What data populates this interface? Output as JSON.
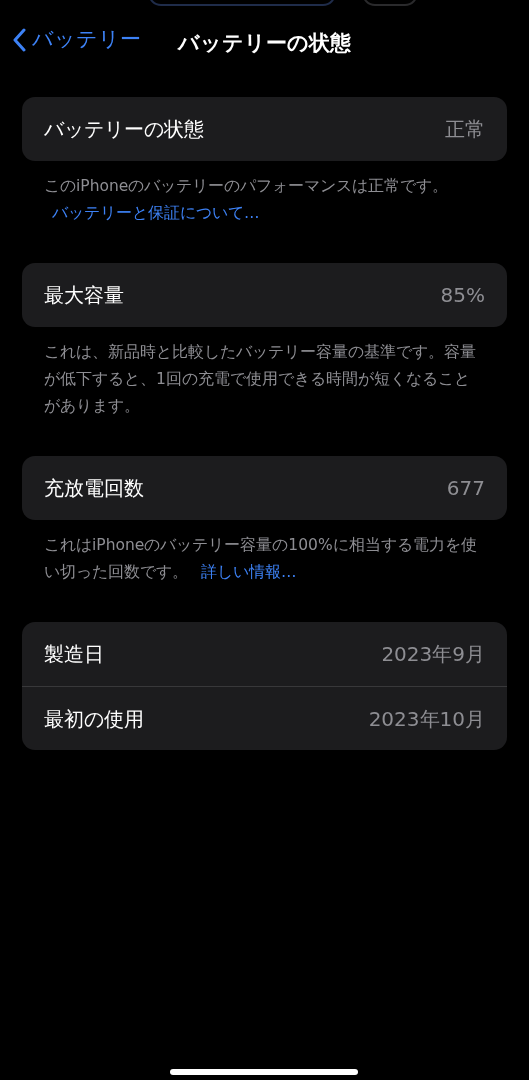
{
  "nav": {
    "back_label": "バッテリー",
    "title": "バッテリーの状態"
  },
  "sections": [
    {
      "rows": [
        {
          "label": "バッテリーの状態",
          "value": "正常"
        }
      ],
      "footer": {
        "text": "このiPhoneのバッテリーのパフォーマンスは正常です。",
        "link": "バッテリーと保証について…"
      }
    },
    {
      "rows": [
        {
          "label": "最大容量",
          "value": "85%"
        }
      ],
      "footer": {
        "text": "これは、新品時と比較したバッテリー容量の基準です。容量が低下すると、1回の充電で使用できる時間が短くなることがあります。"
      }
    },
    {
      "rows": [
        {
          "label": "充放電回数",
          "value": "677"
        }
      ],
      "footer": {
        "text": "これはiPhoneのバッテリー容量の100%に相当する電力を使い切った回数です。",
        "link": "詳しい情報…"
      }
    },
    {
      "rows": [
        {
          "label": "製造日",
          "value": "2023年9月"
        },
        {
          "label": "最初の使用",
          "value": "2023年10月"
        }
      ]
    }
  ]
}
